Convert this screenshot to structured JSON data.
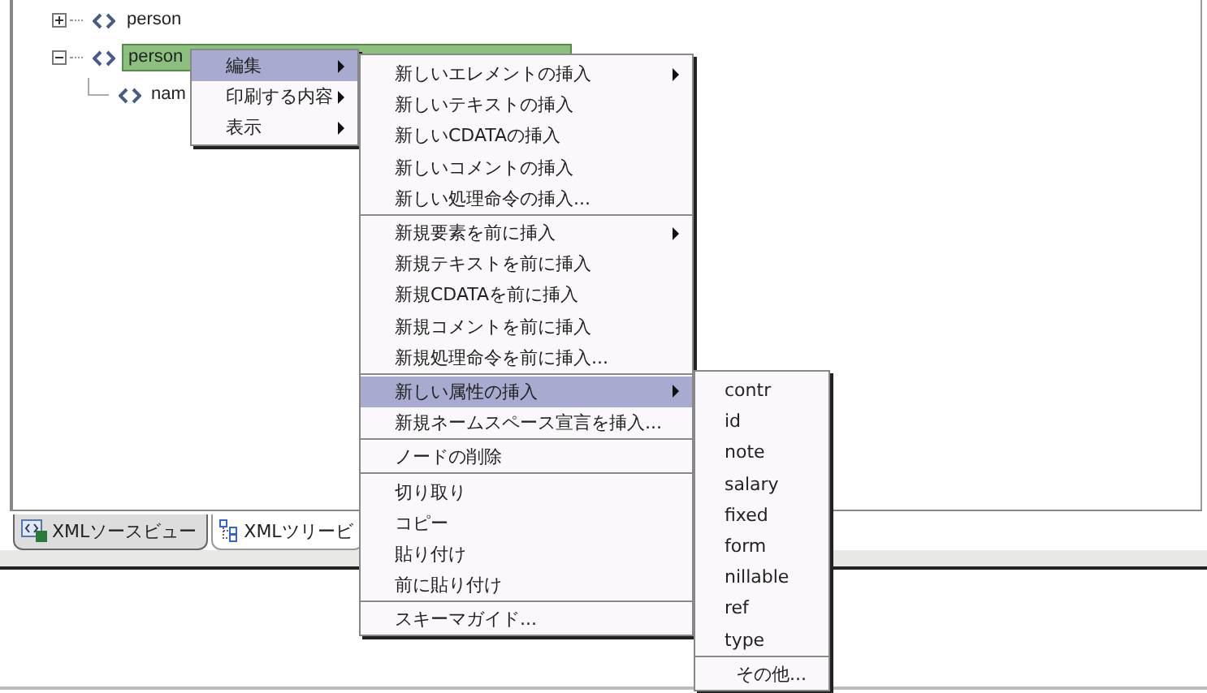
{
  "tree": {
    "nodes": [
      {
        "label": "person",
        "expanded": false,
        "selected": false
      },
      {
        "label": "person",
        "expanded": true,
        "selected": true,
        "children": [
          {
            "label": "nam"
          }
        ]
      }
    ]
  },
  "context_menu": {
    "items": [
      {
        "label": "編集",
        "has_submenu": true,
        "selected": true
      },
      {
        "label": "印刷する内容",
        "has_submenu": true,
        "selected": false
      },
      {
        "label": "表示",
        "has_submenu": true,
        "selected": false
      }
    ]
  },
  "edit_menu": {
    "groups": [
      [
        {
          "label": "新しいエレメントの挿入",
          "has_submenu": true,
          "selected": false
        },
        {
          "label": "新しいテキストの挿入",
          "has_submenu": false,
          "selected": false
        },
        {
          "label": "新しいCDATAの挿入",
          "has_submenu": false,
          "selected": false
        },
        {
          "label": "新しいコメントの挿入",
          "has_submenu": false,
          "selected": false
        },
        {
          "label": "新しい処理命令の挿入...",
          "has_submenu": false,
          "selected": false
        }
      ],
      [
        {
          "label": "新規要素を前に挿入",
          "has_submenu": true,
          "selected": false
        },
        {
          "label": "新規テキストを前に挿入",
          "has_submenu": false,
          "selected": false
        },
        {
          "label": "新規CDATAを前に挿入",
          "has_submenu": false,
          "selected": false
        },
        {
          "label": "新規コメントを前に挿入",
          "has_submenu": false,
          "selected": false
        },
        {
          "label": "新規処理命令を前に挿入...",
          "has_submenu": false,
          "selected": false
        }
      ],
      [
        {
          "label": "新しい属性の挿入",
          "has_submenu": true,
          "selected": true
        },
        {
          "label": "新規ネームスペース宣言を挿入...",
          "has_submenu": false,
          "selected": false
        }
      ],
      [
        {
          "label": "ノードの削除",
          "has_submenu": false,
          "selected": false
        }
      ],
      [
        {
          "label": "切り取り",
          "has_submenu": false,
          "selected": false
        },
        {
          "label": "コピー",
          "has_submenu": false,
          "selected": false
        },
        {
          "label": "貼り付け",
          "has_submenu": false,
          "selected": false
        },
        {
          "label": "前に貼り付け",
          "has_submenu": false,
          "selected": false
        }
      ],
      [
        {
          "label": "スキーマガイド...",
          "has_submenu": false,
          "selected": false
        }
      ]
    ]
  },
  "attribute_menu": {
    "groups": [
      [
        {
          "label": "contr",
          "selected": false
        },
        {
          "label": "id",
          "selected": false
        },
        {
          "label": "note",
          "selected": false
        },
        {
          "label": "salary",
          "selected": false
        },
        {
          "label": "fixed",
          "selected": false
        },
        {
          "label": "form",
          "selected": false
        },
        {
          "label": "nillable",
          "selected": false
        },
        {
          "label": "ref",
          "selected": false
        },
        {
          "label": "type",
          "selected": false
        }
      ],
      [
        {
          "label": "その他...",
          "selected": false
        }
      ]
    ]
  },
  "tabs": [
    {
      "label": "XMLソースビュー",
      "selected": true
    },
    {
      "label": "XMLツリービ",
      "selected": false
    }
  ]
}
